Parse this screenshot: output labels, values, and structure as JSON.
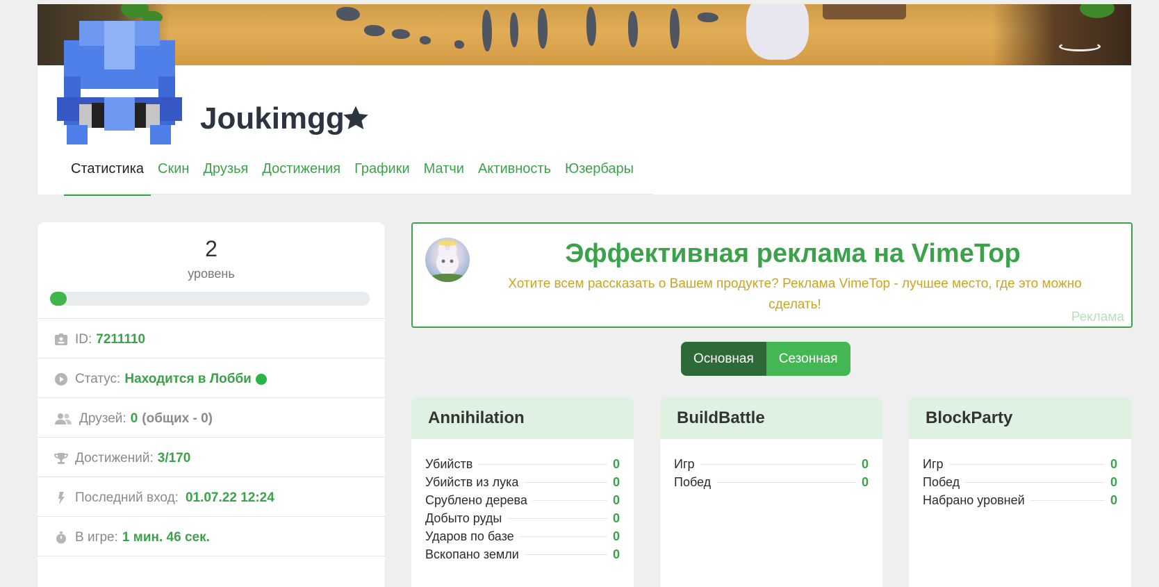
{
  "profile": {
    "username": "Joukimgg"
  },
  "tabs": [
    "Статистика",
    "Скин",
    "Друзья",
    "Достижения",
    "Графики",
    "Матчи",
    "Активность",
    "Юзербары"
  ],
  "level": {
    "number": "2",
    "label": "уровень",
    "progress": 0.02
  },
  "info": {
    "id_label": "ID:",
    "id_value": "7211110",
    "status_label": "Статус:",
    "status_value": "Находится в Лобби",
    "friends_label": "Друзей:",
    "friends_value": "0",
    "friends_common": "(общих - 0)",
    "achievements_label": "Достижений:",
    "achievements_value": "3/170",
    "last_login_label": "Последний вход:",
    "last_login_value": "01.07.22 12:24",
    "playtime_label": "В игре:",
    "playtime_value": "1 мин. 46 сек."
  },
  "ad": {
    "title": "Эффективная реклама на VimeTop",
    "description": "Хотите всем рассказать о Вашем продукте? Реклама VimeTop - лучшее место, где это можно сделать!",
    "label": "Реклама"
  },
  "modes": {
    "primary": "Основная",
    "seasonal": "Сезонная"
  },
  "games": [
    {
      "name": "Annihilation",
      "stats": [
        {
          "label": "Убийств",
          "value": "0"
        },
        {
          "label": "Убийств из лука",
          "value": "0"
        },
        {
          "label": "Срублено дерева",
          "value": "0"
        },
        {
          "label": "Добыто руды",
          "value": "0"
        },
        {
          "label": "Ударов по базе",
          "value": "0"
        },
        {
          "label": "Вскопано земли",
          "value": "0"
        }
      ]
    },
    {
      "name": "BuildBattle",
      "stats": [
        {
          "label": "Игр",
          "value": "0"
        },
        {
          "label": "Побед",
          "value": "0"
        }
      ]
    },
    {
      "name": "BlockParty",
      "stats": [
        {
          "label": "Игр",
          "value": "0"
        },
        {
          "label": "Побед",
          "value": "0"
        },
        {
          "label": "Набрано уровней",
          "value": "0"
        }
      ]
    }
  ],
  "colors": {
    "accent": "#3aa34a",
    "accent_dark": "#2e6a37",
    "ad_text": "#c8a522",
    "game_header_bg": "#dff1e1"
  }
}
